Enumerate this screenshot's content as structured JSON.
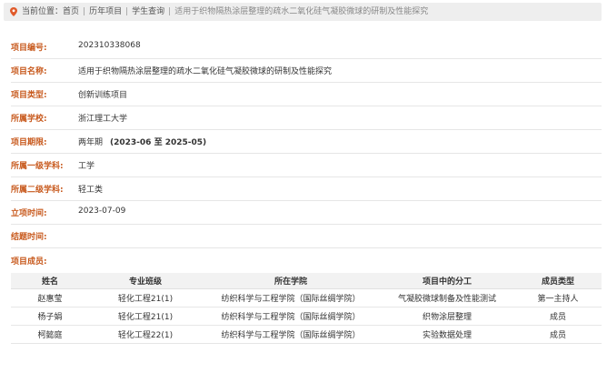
{
  "breadcrumb": {
    "prefix": "当前位置：",
    "items": [
      "首页",
      "历年项目",
      "学生查询"
    ],
    "current": "适用于织物隔热涂层整理的疏水二氧化硅气凝胶微球的研制及性能探究",
    "colors": {
      "pin": "#e05a2a",
      "background": "#eeeeee"
    }
  },
  "fields": [
    {
      "label": "项目编号:",
      "value": "202310338068"
    },
    {
      "label": "项目名称:",
      "value": "适用于织物隔热涂层整理的疏水二氧化硅气凝胶微球的研制及性能探究"
    },
    {
      "label": "项目类型:",
      "value": "创新训练项目"
    },
    {
      "label": "所属学校:",
      "value": "浙江理工大学"
    },
    {
      "label": "项目期限:",
      "value": "两年期",
      "extra": "(2023-06 至 2025-05)"
    },
    {
      "label": "所属一级学科:",
      "value": "工学"
    },
    {
      "label": "所属二级学科:",
      "value": "轻工类"
    },
    {
      "label": "立项时间:",
      "value": "2023-07-09"
    },
    {
      "label": "结题时间:",
      "value": ""
    }
  ],
  "members": {
    "label": "项目成员:",
    "columns": [
      "姓名",
      "专业班级",
      "所在学院",
      "项目中的分工",
      "成员类型"
    ],
    "rows": [
      [
        "赵惠莹",
        "轻化工程21(1)",
        "纺织科学与工程学院（国际丝绸学院）",
        "气凝胶微球制备及性能测试",
        "第一主持人"
      ],
      [
        "杨子娟",
        "轻化工程21(1)",
        "纺织科学与工程学院（国际丝绸学院）",
        "织物涂层整理",
        "成员"
      ],
      [
        "柯懿庭",
        "轻化工程22(1)",
        "纺织科学与工程学院（国际丝绸学院）",
        "实验数据处理",
        "成员"
      ]
    ]
  },
  "colors": {
    "label": "#c85a1e",
    "text": "#333333",
    "divider": "#e6e6e6",
    "header_bg": "#f2f2f2"
  }
}
